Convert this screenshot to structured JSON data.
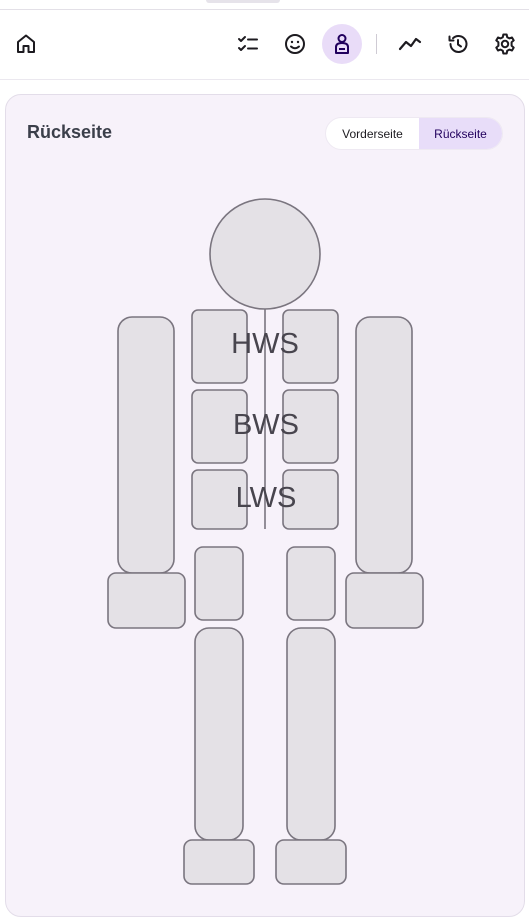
{
  "toolbar": {
    "icons": [
      "home-icon",
      "checklist-icon",
      "smiley-icon",
      "body-icon",
      "trend-icon",
      "history-icon",
      "gear-icon"
    ],
    "active": "body-icon"
  },
  "card": {
    "title": "Rückseite",
    "view_toggle": {
      "front_label": "Vorderseite",
      "back_label": "Rückseite",
      "selected": "Rückseite"
    }
  },
  "body_map": {
    "regions": {
      "hws": "HWS",
      "bws": "BWS",
      "lws": "LWS"
    }
  },
  "colors": {
    "accent_bg": "#e8ddf9",
    "active_icon_bg": "#e9dcf8",
    "card_bg": "#f7f2fa",
    "part_fill": "#e4e1e6",
    "part_stroke": "#7a757f"
  }
}
